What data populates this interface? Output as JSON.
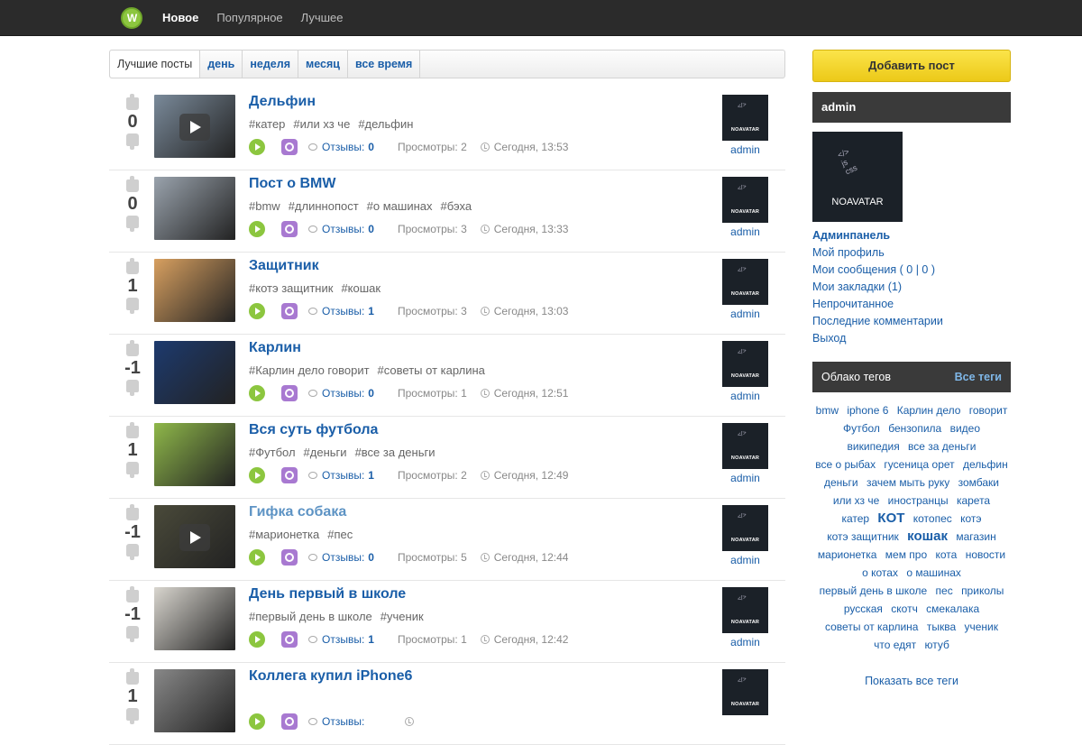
{
  "topbar": {
    "logo_text": "W",
    "nav": [
      "Новое",
      "Популярное",
      "Лучшее"
    ]
  },
  "filter": {
    "label": "Лучшие посты",
    "items": [
      "день",
      "неделя",
      "месяц",
      "все время"
    ]
  },
  "posts": [
    {
      "score": "0",
      "title": "Дельфин",
      "tags": [
        "#катер",
        "#или хз че",
        "#дельфин"
      ],
      "comments_label": "Отзывы:",
      "comments": "0",
      "views": "Просмотры: 2",
      "time": "Сегодня, 13:53",
      "author": "admin",
      "video": true,
      "thumb_color": "#7a8a9a"
    },
    {
      "score": "0",
      "title": "Пост о BMW",
      "tags": [
        "#bmw",
        "#длиннопост",
        "#о машинах",
        "#бэха"
      ],
      "comments_label": "Отзывы:",
      "comments": "0",
      "views": "Просмотры: 3",
      "time": "Сегодня, 13:33",
      "author": "admin",
      "video": false,
      "thumb_color": "#9aa3ad"
    },
    {
      "score": "1",
      "title": "Защитник",
      "tags": [
        "#котэ защитник",
        "#кошак"
      ],
      "comments_label": "Отзывы:",
      "comments": "1",
      "views": "Просмотры: 3",
      "time": "Сегодня, 13:03",
      "author": "admin",
      "video": false,
      "thumb_color": "#d8a060"
    },
    {
      "score": "-1",
      "title": "Карлин",
      "tags": [
        "#Карлин дело говорит",
        "#советы от карлина"
      ],
      "comments_label": "Отзывы:",
      "comments": "0",
      "views": "Просмотры: 1",
      "time": "Сегодня, 12:51",
      "author": "admin",
      "video": false,
      "thumb_color": "#1d3a6e"
    },
    {
      "score": "1",
      "title": "Вся суть футбола",
      "tags": [
        "#Футбол",
        "#деньги",
        "#все за деньги"
      ],
      "comments_label": "Отзывы:",
      "comments": "1",
      "views": "Просмотры: 2",
      "time": "Сегодня, 12:49",
      "author": "admin",
      "video": false,
      "thumb_color": "#8fb84a"
    },
    {
      "score": "-1",
      "title": "Гифка собака",
      "tags": [
        "#марионетка",
        "#пес"
      ],
      "comments_label": "Отзывы:",
      "comments": "0",
      "views": "Просмотры: 5",
      "time": "Сегодня, 12:44",
      "author": "admin",
      "video": true,
      "thumb_color": "#4a4a3a",
      "visited": true
    },
    {
      "score": "-1",
      "title": "День первый в школе",
      "tags": [
        "#первый день в школе",
        "#ученик"
      ],
      "comments_label": "Отзывы:",
      "comments": "1",
      "views": "Просмотры: 1",
      "time": "Сегодня, 12:42",
      "author": "admin",
      "video": false,
      "thumb_color": "#d9d6cf"
    },
    {
      "score": "1",
      "title": "Коллега купил iPhone6",
      "tags": [],
      "comments_label": "Отзывы:",
      "comments": "",
      "views": "",
      "time": "",
      "author": "",
      "video": false,
      "thumb_color": "#888888"
    }
  ],
  "avatar_text": "NOAVATAR",
  "sidebar": {
    "add_post": "Добавить пост",
    "username": "admin",
    "menu": [
      "Админпанель",
      "Мой профиль",
      "Мои сообщения ( 0 | 0 )",
      "Мои закладки (1)",
      "Непрочитанное",
      "Последние комментарии",
      "Выход"
    ],
    "tags_title": "Облако тегов",
    "tags_all": "Все теги",
    "cloud": [
      {
        "t": "bmw"
      },
      {
        "t": "iphone 6"
      },
      {
        "t": "Карлин дело"
      },
      {
        "t": "говорит"
      },
      {
        "t": "Футбол"
      },
      {
        "t": "бензопила"
      },
      {
        "t": "видео"
      },
      {
        "t": "википедия"
      },
      {
        "t": "все за деньги"
      },
      {
        "t": "все о рыбах"
      },
      {
        "t": "гусеница орет"
      },
      {
        "t": "дельфин"
      },
      {
        "t": "деньги"
      },
      {
        "t": "зачем мыть руку"
      },
      {
        "t": "зомбаки"
      },
      {
        "t": "или хз че"
      },
      {
        "t": "иностранцы"
      },
      {
        "t": "карета"
      },
      {
        "t": "катер"
      },
      {
        "t": "КОТ",
        "big": true
      },
      {
        "t": "котопес"
      },
      {
        "t": "котэ"
      },
      {
        "t": "котэ защитник"
      },
      {
        "t": "кошак",
        "big": true
      },
      {
        "t": "магазин"
      },
      {
        "t": "марионетка"
      },
      {
        "t": "мем про"
      },
      {
        "t": "кота"
      },
      {
        "t": "новости"
      },
      {
        "t": "о котах"
      },
      {
        "t": "о машинах"
      },
      {
        "t": "первый день в школе"
      },
      {
        "t": "пес"
      },
      {
        "t": "приколы"
      },
      {
        "t": "русская"
      },
      {
        "t": "скотч"
      },
      {
        "t": "смекалака"
      },
      {
        "t": "советы от карлина"
      },
      {
        "t": "тыква"
      },
      {
        "t": "ученик"
      },
      {
        "t": "что едят"
      },
      {
        "t": "ютуб"
      }
    ],
    "show_all_tags": "Показать все теги"
  },
  "colors": {
    "accent": "#1a5ea8",
    "topbar": "#2b2b2b",
    "add_button": "#f3d52c",
    "play": "#8cc63f",
    "bookmark": "#a879d1"
  }
}
